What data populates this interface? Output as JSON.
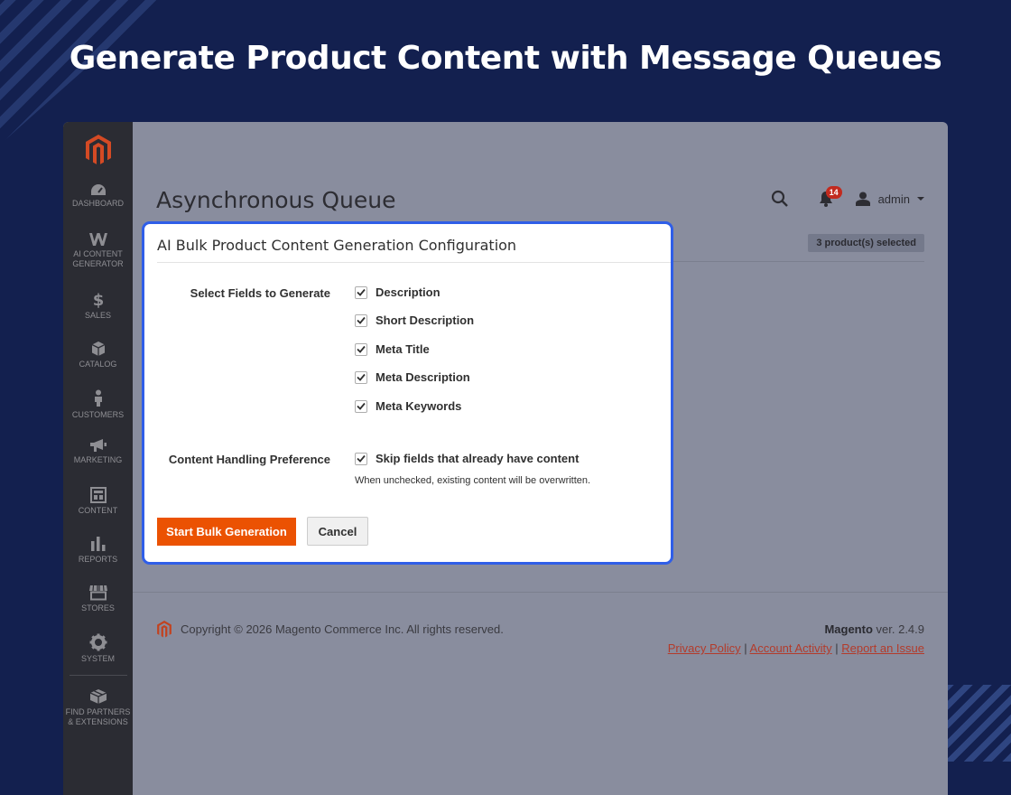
{
  "hero": {
    "title": "Generate Product Content with Message Queues"
  },
  "sidebar": {
    "items": [
      {
        "label": "DASHBOARD",
        "icon": "dashboard-icon"
      },
      {
        "label": "AI CONTENT GENERATOR",
        "icon": "ai-content-icon"
      },
      {
        "label": "SALES",
        "icon": "dollar-icon"
      },
      {
        "label": "CATALOG",
        "icon": "box-icon"
      },
      {
        "label": "CUSTOMERS",
        "icon": "person-icon"
      },
      {
        "label": "MARKETING",
        "icon": "megaphone-icon"
      },
      {
        "label": "CONTENT",
        "icon": "layout-icon"
      },
      {
        "label": "REPORTS",
        "icon": "bar-chart-icon"
      },
      {
        "label": "STORES",
        "icon": "store-icon"
      },
      {
        "label": "SYSTEM",
        "icon": "gear-icon"
      },
      {
        "label": "FIND PARTNERS & EXTENSIONS",
        "icon": "extensions-icon"
      }
    ]
  },
  "header": {
    "page_title": "Asynchronous Queue",
    "notification_count": "14",
    "user": "admin"
  },
  "grid": {
    "selected_badge": "3 product(s) selected"
  },
  "modal": {
    "title": "AI Bulk Product Content Generation Configuration",
    "fields_label": "Select Fields to Generate",
    "fields": [
      {
        "label": "Description",
        "checked": true
      },
      {
        "label": "Short Description",
        "checked": true
      },
      {
        "label": "Meta Title",
        "checked": true
      },
      {
        "label": "Meta Description",
        "checked": true
      },
      {
        "label": "Meta Keywords",
        "checked": true
      }
    ],
    "handling_label": "Content Handling Preference",
    "skip_label": "Skip fields that already have content",
    "skip_checked": true,
    "note": "When unchecked, existing content will be overwritten.",
    "primary_button": "Start Bulk Generation",
    "cancel_button": "Cancel"
  },
  "footer": {
    "copyright": "Copyright © 2026 Magento Commerce Inc. All rights reserved.",
    "brand": "Magento",
    "version": " ver. 2.4.9",
    "links": [
      "Privacy Policy",
      "Account Activity",
      "Report an Issue"
    ]
  },
  "colors": {
    "background": "#13204f",
    "accent": "#eb5202",
    "modal_border": "#2f5ee8",
    "sidebar": "#2b2c33"
  }
}
